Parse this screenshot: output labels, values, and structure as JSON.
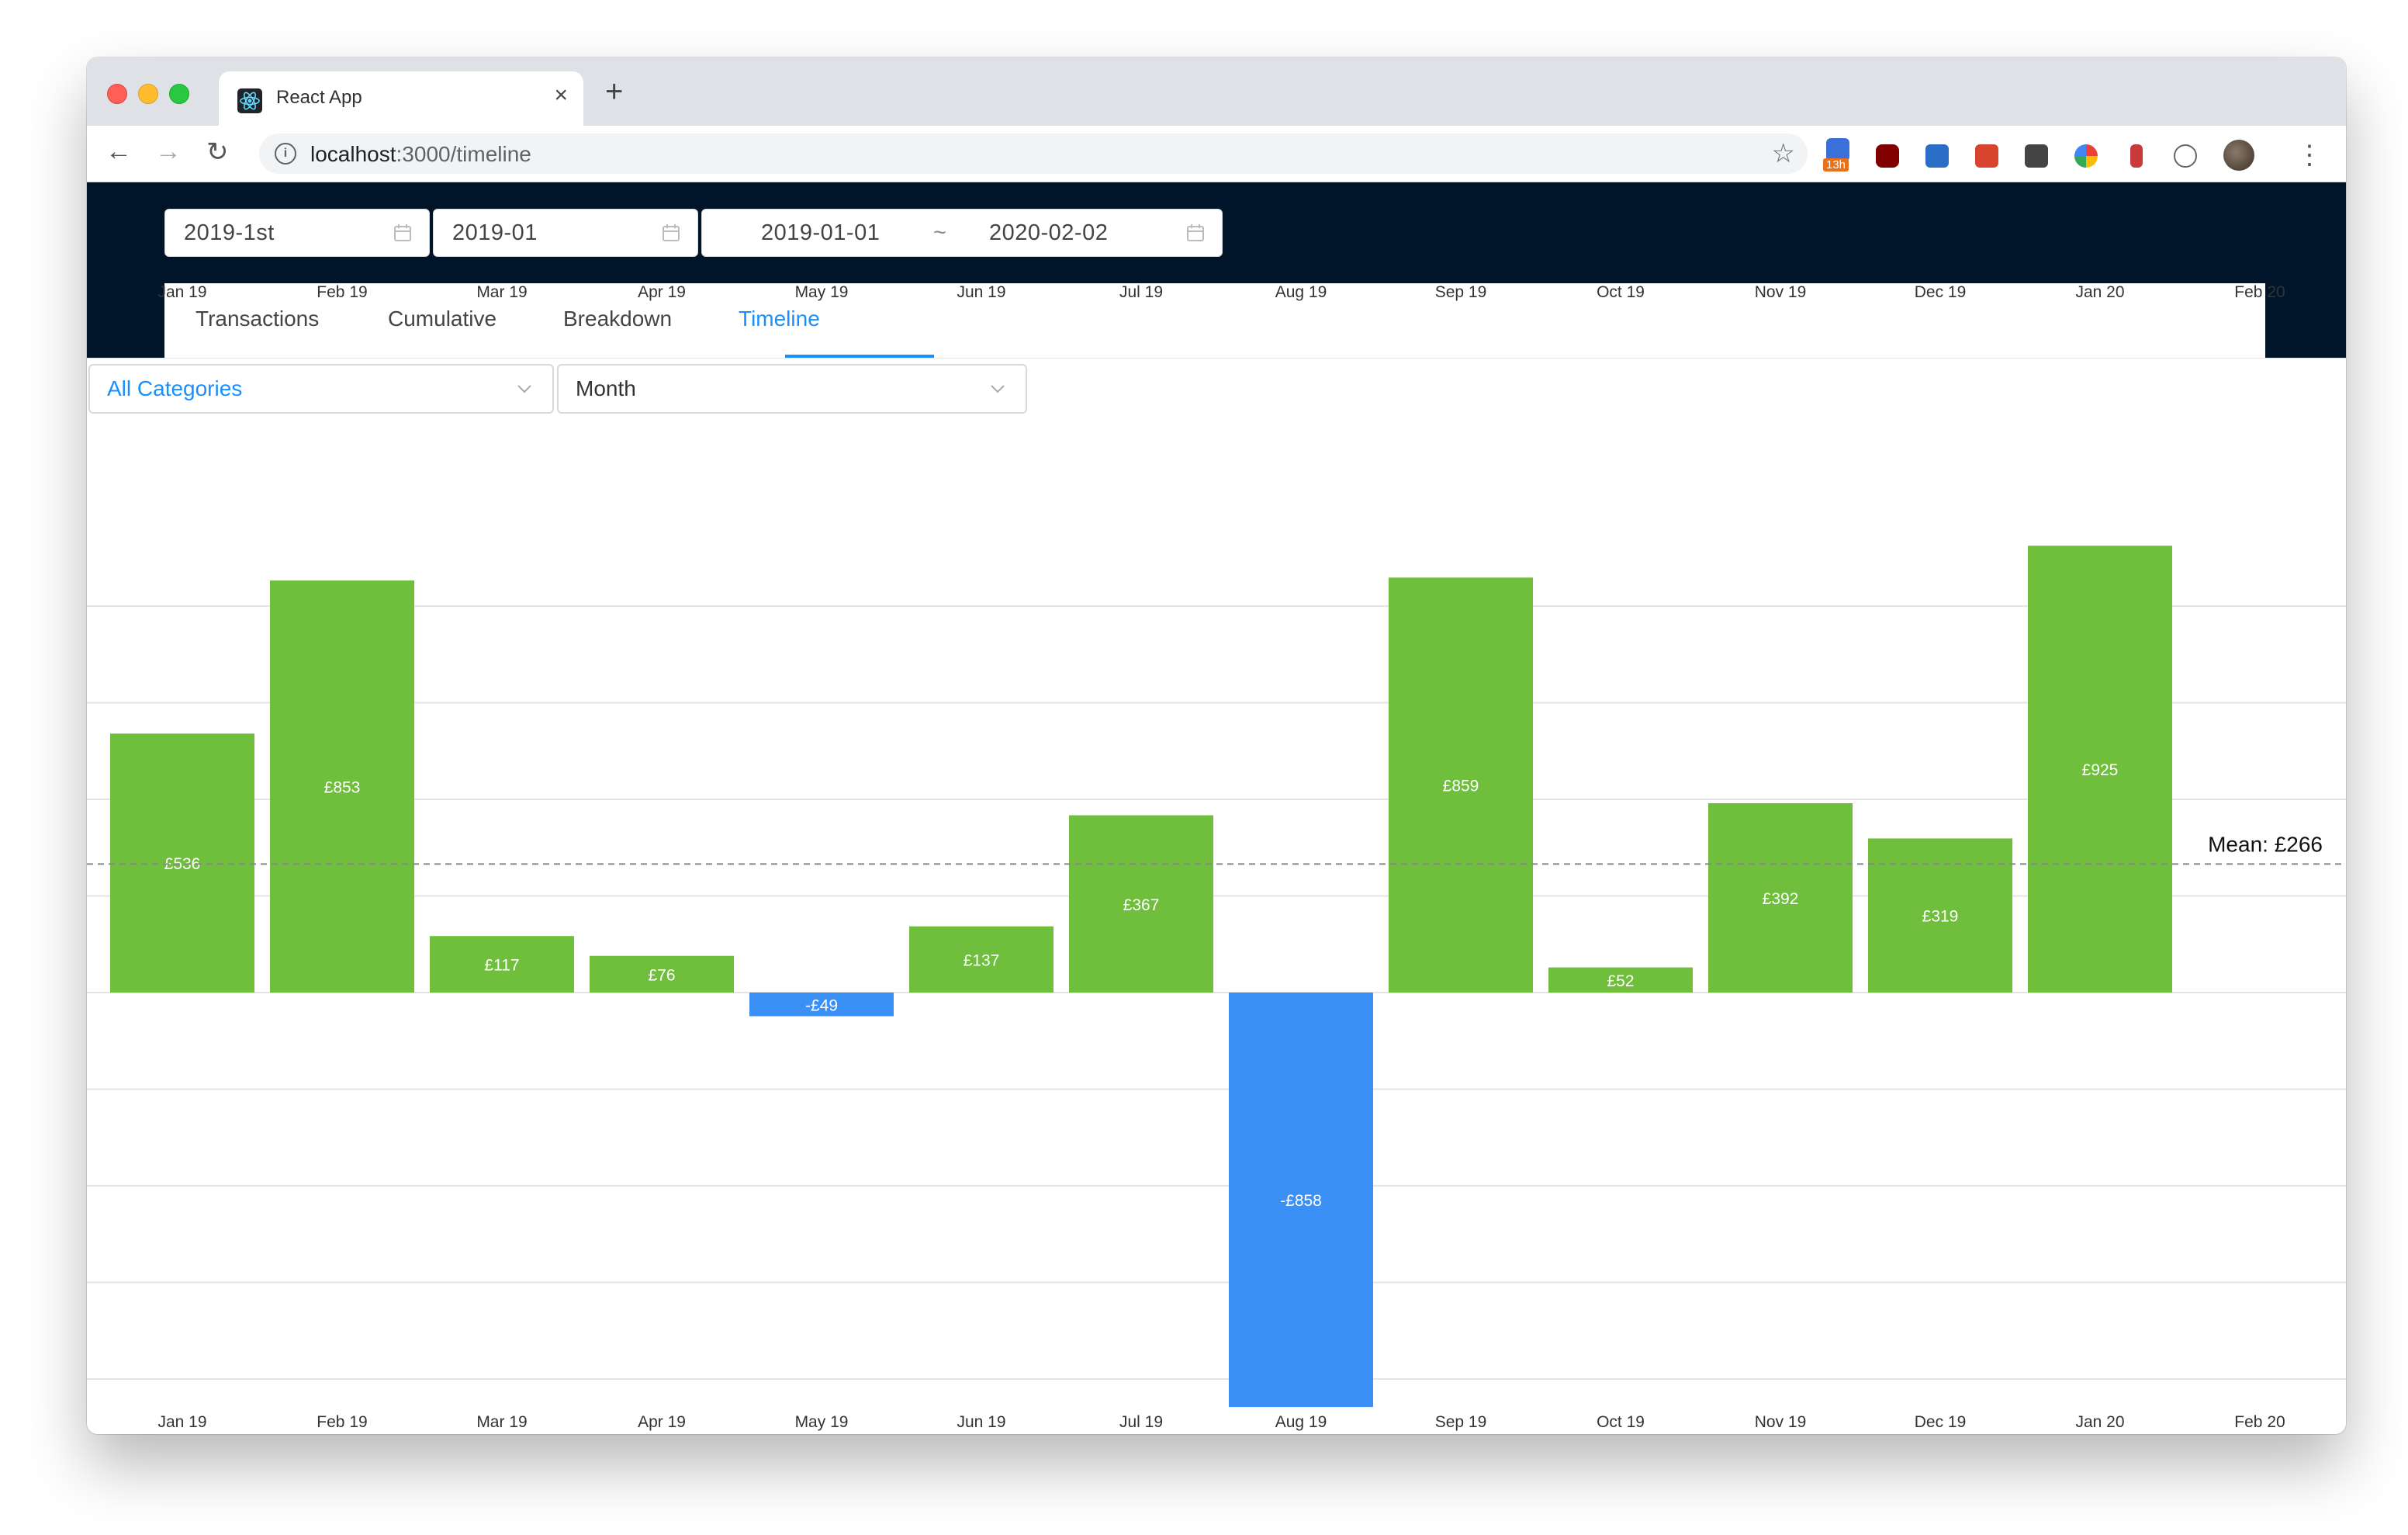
{
  "browser": {
    "tab_title": "React App",
    "tab_close": "×",
    "new_tab": "+",
    "url_host": "localhost",
    "url_path": ":3000/timeline",
    "back": "←",
    "forward": "→",
    "reload": "↻",
    "star": "☆",
    "ext_badge": "13h",
    "menu": "⋮"
  },
  "filters": {
    "year_quarter": "2019-1st",
    "month": "2019-01",
    "range_start": "2019-01-01",
    "range_sep": "~",
    "range_end": "2020-02-02"
  },
  "tabs": [
    {
      "label": "Transactions"
    },
    {
      "label": "Cumulative"
    },
    {
      "label": "Breakdown"
    },
    {
      "label": "Timeline"
    }
  ],
  "active_tab": "Timeline",
  "selects": {
    "category": "All Categories",
    "granularity": "Month"
  },
  "colors": {
    "positive": "#6fbf3d",
    "negative": "#3a90f5",
    "accent": "#1890ff",
    "header": "#001529"
  },
  "chart_data": {
    "type": "bar",
    "categories": [
      "Jan 19",
      "Feb 19",
      "Mar 19",
      "Apr 19",
      "May 19",
      "Jun 19",
      "Jul 19",
      "Aug 19",
      "Sep 19",
      "Oct 19",
      "Nov 19",
      "Dec 19",
      "Jan 20",
      "Feb 20"
    ],
    "values": [
      536,
      853,
      117,
      76,
      -49,
      137,
      367,
      -858,
      859,
      52,
      392,
      319,
      925,
      null
    ],
    "labels": [
      "£536",
      "£853",
      "£117",
      "£76",
      "-£49",
      "£137",
      "£367",
      "-£858",
      "£859",
      "£52",
      "£392",
      "£319",
      "£925",
      ""
    ],
    "mean": 266,
    "mean_label": "Mean: £266",
    "ylim": [
      -800,
      800
    ],
    "grid": true,
    "x_axis_top": true,
    "x_axis_bottom": true
  }
}
